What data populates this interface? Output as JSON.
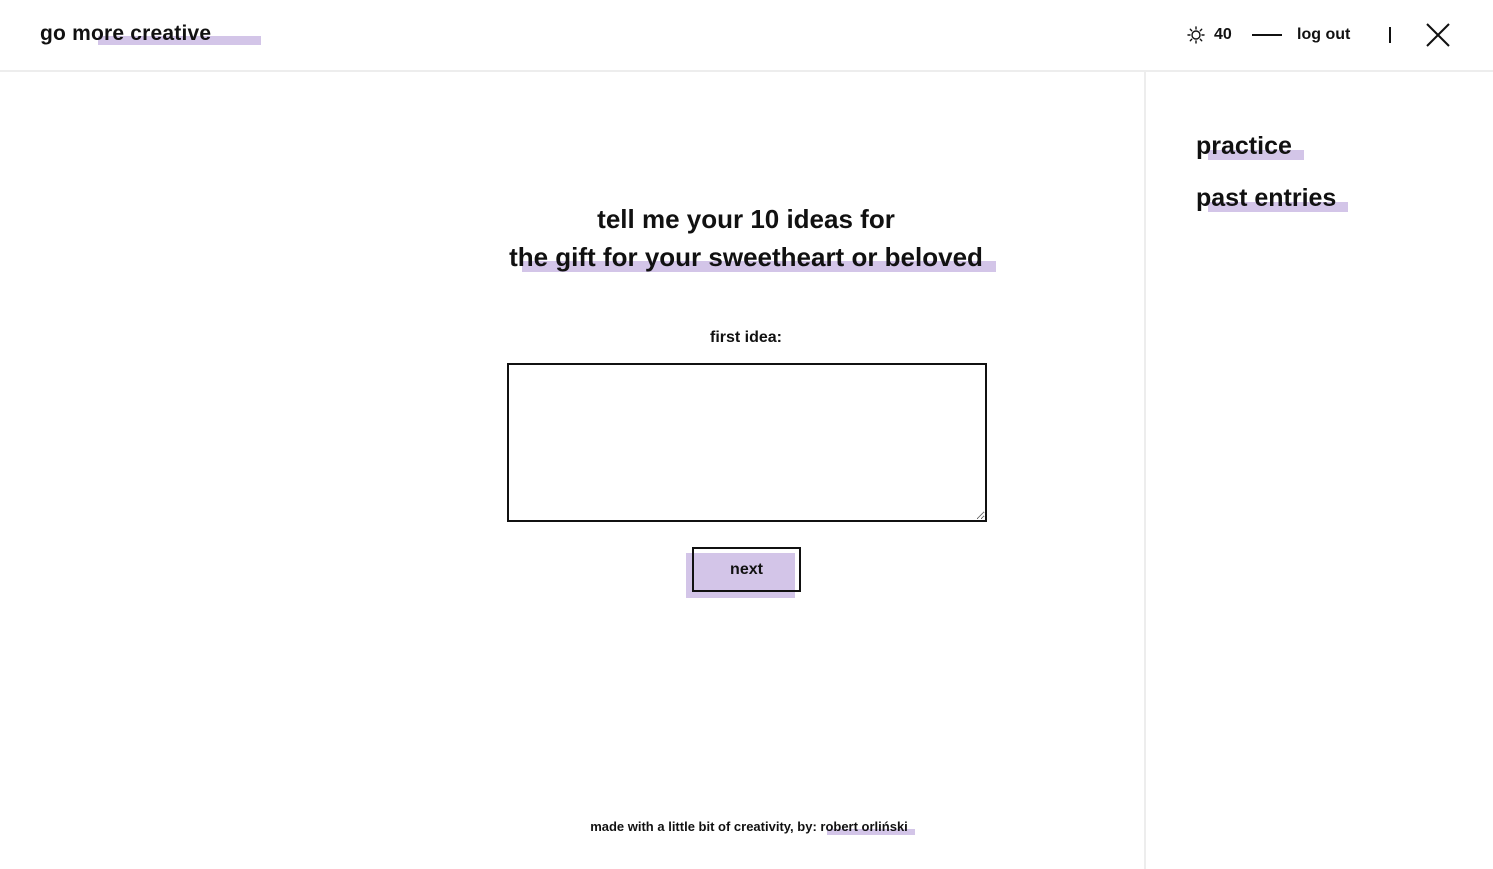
{
  "header": {
    "brand": "go more creative",
    "points": "40",
    "logout_label": "log out"
  },
  "sidebar": {
    "items": [
      {
        "label": "practice"
      },
      {
        "label": "past entries"
      }
    ]
  },
  "main": {
    "prompt_line1": "tell me your 10 ideas for",
    "prompt_line2": "the gift for your sweetheart or beloved",
    "idea_label": "first idea:",
    "idea_value": "",
    "next_label": "next"
  },
  "footer": {
    "text": "made with a little bit of creativity, by: ",
    "author": "robert orliński"
  },
  "colors": {
    "accent": "#d3c5e8",
    "text": "#111111",
    "divider": "#ededed"
  },
  "icons": [
    "sun-icon",
    "close-icon"
  ]
}
